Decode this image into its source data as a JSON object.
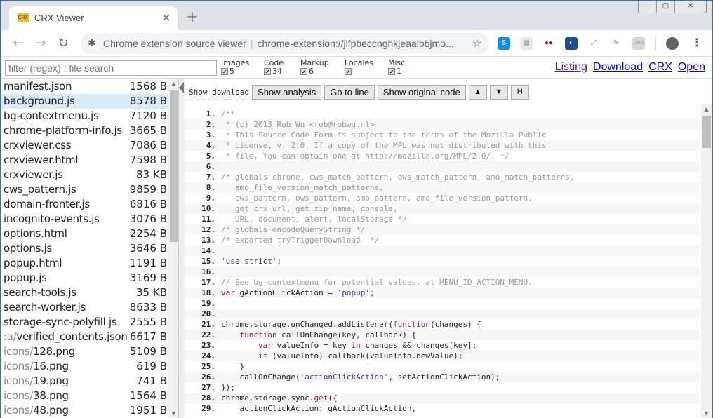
{
  "browser": {
    "tab_title": "CRX Viewer",
    "favicon_text": "CRX",
    "tab_close": "×",
    "new_tab": "+",
    "window_controls": {
      "minimize": "—",
      "maximize": "▢",
      "close": "✕"
    },
    "nav": {
      "back": "←",
      "forward": "→",
      "reload": "↻"
    },
    "omnibox": {
      "site_label": "Chrome extension source viewer",
      "url": "chrome-extension://jifpbeccnghkjeaalbbjmo..."
    },
    "star": "☆",
    "extensions": [
      {
        "name": "skype-extension-icon",
        "label": "S",
        "color": "#1a8fe0",
        "fg": "#ffffff"
      },
      {
        "name": "clipboard-extension-icon",
        "label": "▤",
        "color": "#e8e8e8",
        "fg": "#888888"
      },
      {
        "name": "incognito-extension-icon",
        "label": "●●",
        "color": "#ffffff",
        "fg": "#8b1a2a"
      },
      {
        "name": "steam-extension-icon",
        "label": "◐",
        "color": "#1f4e8a",
        "fg": "#ffffff"
      },
      {
        "name": "screenshot-extension-icon",
        "label": "⤢",
        "color": "#ffffff",
        "fg": "#e0833a"
      },
      {
        "name": "color-picker-extension-icon",
        "label": "✎",
        "color": "#ffffff",
        "fg": "#7a4fc0"
      },
      {
        "name": "crx-extension-icon",
        "label": "CRX",
        "color": "#d6d6d6",
        "fg": "#999999"
      }
    ],
    "menu": "⋮"
  },
  "filter": {
    "placeholder": "filter (regex) ! file search",
    "categories": [
      {
        "label": "Images",
        "checked": true,
        "count": "5"
      },
      {
        "label": "Code",
        "checked": true,
        "count": "34"
      },
      {
        "label": "Markup",
        "checked": true,
        "count": "6"
      },
      {
        "label": "Locales",
        "checked": true,
        "count": ""
      },
      {
        "label": "Misc",
        "checked": true,
        "count": "1"
      }
    ],
    "links": [
      "Listing",
      "Download",
      "CRX",
      "Open"
    ]
  },
  "files": [
    {
      "dir": "",
      "name": "manifest.json",
      "size": "1568 B"
    },
    {
      "dir": "",
      "name": "background.js",
      "size": "8578 B",
      "selected": true
    },
    {
      "dir": "",
      "name": "bg-contextmenu.js",
      "size": "7120 B"
    },
    {
      "dir": "",
      "name": "chrome-platform-info.js",
      "size": "3665 B"
    },
    {
      "dir": "",
      "name": "crxviewer.css",
      "size": "7086 B"
    },
    {
      "dir": "",
      "name": "crxviewer.html",
      "size": "7598 B"
    },
    {
      "dir": "",
      "name": "crxviewer.js",
      "size": "83 KB"
    },
    {
      "dir": "",
      "name": "cws_pattern.js",
      "size": "9859 B"
    },
    {
      "dir": "",
      "name": "domain-fronter.js",
      "size": "6816 B"
    },
    {
      "dir": "",
      "name": "incognito-events.js",
      "size": "3076 B"
    },
    {
      "dir": "",
      "name": "options.html",
      "size": "2254 B"
    },
    {
      "dir": "",
      "name": "options.js",
      "size": "3646 B"
    },
    {
      "dir": "",
      "name": "popup.html",
      "size": "1191 B"
    },
    {
      "dir": "",
      "name": "popup.js",
      "size": "3169 B"
    },
    {
      "dir": "",
      "name": "search-tools.js",
      "size": "35 KB"
    },
    {
      "dir": "",
      "name": "search-worker.js",
      "size": "8633 B"
    },
    {
      "dir": "",
      "name": "storage-sync-polyfill.js",
      "size": "2555 B"
    },
    {
      "dir": ":a/",
      "name": "verified_contents.json",
      "size": "6617 B"
    },
    {
      "dir": "icons/",
      "name": "128.png",
      "size": "5109 B"
    },
    {
      "dir": "icons/",
      "name": "16.png",
      "size": "619 B"
    },
    {
      "dir": "icons/",
      "name": "19.png",
      "size": "741 B"
    },
    {
      "dir": "icons/",
      "name": "38.png",
      "size": "1564 B"
    },
    {
      "dir": "icons/",
      "name": "48.png",
      "size": "1951 B"
    }
  ],
  "viewer": {
    "show_download": "Show download",
    "buttons": [
      "Show analysis",
      "Go to line",
      "Show original code"
    ],
    "small_buttons": [
      {
        "name": "prev-match-button",
        "label": "▲"
      },
      {
        "name": "next-match-button",
        "label": "▼"
      },
      {
        "name": "highlight-button",
        "label": "H"
      }
    ]
  },
  "code_lines": [
    [
      [
        "c-com",
        "/**"
      ]
    ],
    [
      [
        "c-com",
        " * (c) 2013 Rob Wu <rob@robwu.nl>"
      ]
    ],
    [
      [
        "c-com",
        " * This Source Code Form is subject to the terms of the Mozilla Public"
      ]
    ],
    [
      [
        "c-com",
        " * License, v. 2.0. If a copy of the MPL was not distributed with this"
      ]
    ],
    [
      [
        "c-com",
        " * file, You can obtain one at http://mozilla.org/MPL/2.0/. */"
      ]
    ],
    [],
    [
      [
        "c-com",
        "/* globals chrome, cws_match_pattern, ows_match_pattern, amo_match_patterns,"
      ]
    ],
    [
      [
        "c-com",
        "   amo_file_version_match_patterns,"
      ]
    ],
    [
      [
        "c-com",
        "   cws_pattern, ows_pattern, amo_pattern, amo_file_version_pattern,"
      ]
    ],
    [
      [
        "c-com",
        "   get_crx_url, get_zip_name, console,"
      ]
    ],
    [
      [
        "c-com",
        "   URL, document, alert, localStorage */"
      ]
    ],
    [
      [
        "c-com",
        "/* globals encodeQueryString */"
      ]
    ],
    [
      [
        "c-com",
        "/* exported tryTriggerDownload  */"
      ]
    ],
    [],
    [
      [
        "c-str",
        "'use strict'"
      ],
      [
        "c-pl",
        ";"
      ]
    ],
    [],
    [
      [
        "c-com",
        "// See bg-contextmenu for potential values, at MENU_ID_ACTION_MENU."
      ]
    ],
    [
      [
        "c-kw",
        "var"
      ],
      [
        "c-pl",
        " gActionClickAction = "
      ],
      [
        "c-str",
        "'popup'"
      ],
      [
        "c-pl",
        ";"
      ]
    ],
    [],
    [],
    [
      [
        "c-pl",
        "chrome.storage.onChanged.addListener("
      ],
      [
        "c-kw",
        "function"
      ],
      [
        "c-pl",
        "(changes) {"
      ]
    ],
    [
      [
        "c-pl",
        "    "
      ],
      [
        "c-kw",
        "function"
      ],
      [
        "c-pl",
        " callOnChange(key, callback) {"
      ]
    ],
    [
      [
        "c-pl",
        "        "
      ],
      [
        "c-kw",
        "var"
      ],
      [
        "c-pl",
        " valueInfo = key "
      ],
      [
        "c-kw",
        "in"
      ],
      [
        "c-pl",
        " changes && changes[key];"
      ]
    ],
    [
      [
        "c-pl",
        "        "
      ],
      [
        "c-kw",
        "if"
      ],
      [
        "c-pl",
        " (valueInfo) callback(valueInfo.newValue);"
      ]
    ],
    [
      [
        "c-pl",
        "    }"
      ]
    ],
    [
      [
        "c-pl",
        "    callOnChange("
      ],
      [
        "c-str",
        "'actionClickAction'"
      ],
      [
        "c-pl",
        ", setActionClickAction);"
      ]
    ],
    [
      [
        "c-pl",
        "});"
      ]
    ],
    [
      [
        "c-pl",
        "chrome.storage.sync."
      ],
      [
        "c-kw",
        "get"
      ],
      [
        "c-pl",
        "({"
      ]
    ],
    [
      [
        "c-pl",
        "    actionClickAction: gActionClickAction,"
      ]
    ]
  ]
}
